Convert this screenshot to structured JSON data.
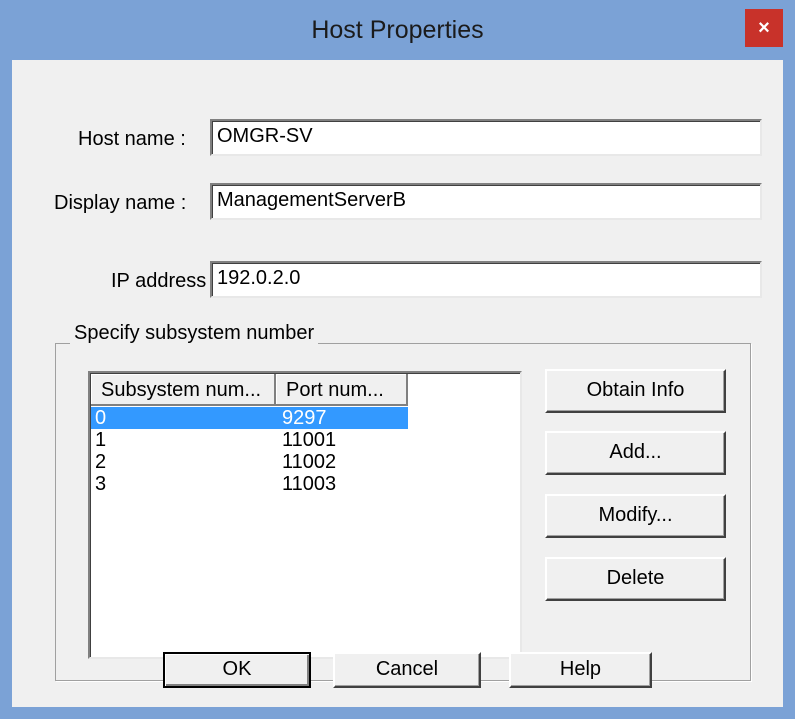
{
  "window": {
    "title": "Host Properties",
    "close_glyph": "×",
    "frame_color": "#7ba2d6",
    "close_color": "#c8322a",
    "selection_color": "#3399ff"
  },
  "fields": {
    "host_name": {
      "label": "Host name :",
      "value": "OMGR-SV"
    },
    "display_name": {
      "label": "Display name :",
      "value": "ManagementServerB"
    },
    "ip_address": {
      "label": "IP address :",
      "value": "192.0.2.0"
    }
  },
  "subsystem_group": {
    "title": "Specify subsystem number",
    "columns": [
      "Subsystem num...",
      "Port num..."
    ],
    "rows": [
      {
        "subsystem": "0",
        "port": "9297",
        "selected": true
      },
      {
        "subsystem": "1",
        "port": "11001",
        "selected": false
      },
      {
        "subsystem": "2",
        "port": "11002",
        "selected": false
      },
      {
        "subsystem": "3",
        "port": "11003",
        "selected": false
      }
    ],
    "buttons": {
      "obtain_info": "Obtain Info",
      "add": "Add...",
      "modify": "Modify...",
      "delete": "Delete"
    }
  },
  "footer": {
    "ok": "OK",
    "cancel": "Cancel",
    "help": "Help"
  }
}
